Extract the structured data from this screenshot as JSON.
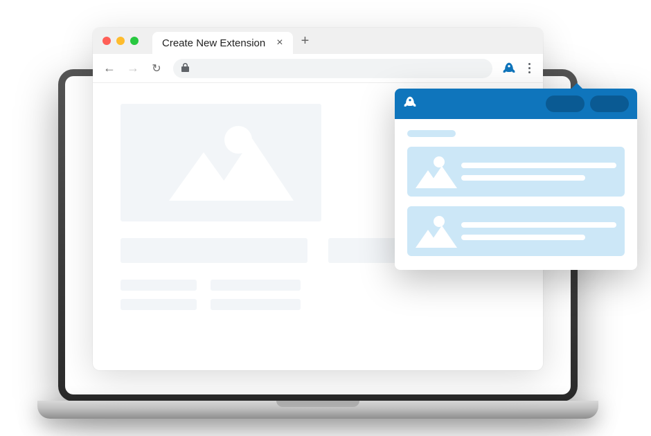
{
  "browser": {
    "tab_title": "Create New Extension",
    "close_glyph": "×",
    "new_tab_glyph": "+",
    "nav": {
      "back": "←",
      "forward": "→",
      "reload": "↻"
    }
  },
  "extension_popup": {
    "icon": "rocket-icon"
  },
  "colors": {
    "brand_blue": "#0f75bc",
    "light_blue": "#cce7f7"
  }
}
